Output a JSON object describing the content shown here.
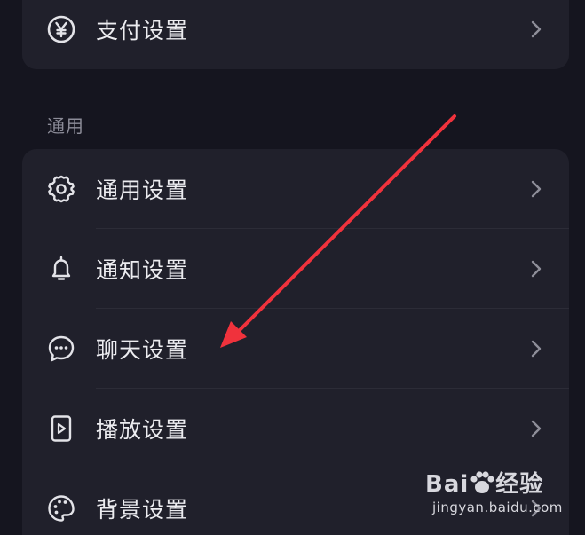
{
  "top_section": {
    "items": [
      {
        "label": "支付设置",
        "icon": "yen-circle-icon"
      }
    ]
  },
  "general_section": {
    "title": "通用",
    "items": [
      {
        "label": "通用设置",
        "icon": "gear-icon"
      },
      {
        "label": "通知设置",
        "icon": "bell-icon"
      },
      {
        "label": "聊天设置",
        "icon": "chat-bubble-icon"
      },
      {
        "label": "播放设置",
        "icon": "play-file-icon"
      },
      {
        "label": "背景设置",
        "icon": "palette-icon"
      }
    ]
  },
  "watermark": {
    "brand": "Bai",
    "brand_suffix": "经验",
    "url": "jingyan.baidu.com"
  },
  "colors": {
    "background": "#15151f",
    "card": "#20202b",
    "text": "#ececf0",
    "section_title": "#8c8c98",
    "chevron": "#8e8e99",
    "annotation_arrow": "#f0323c"
  }
}
